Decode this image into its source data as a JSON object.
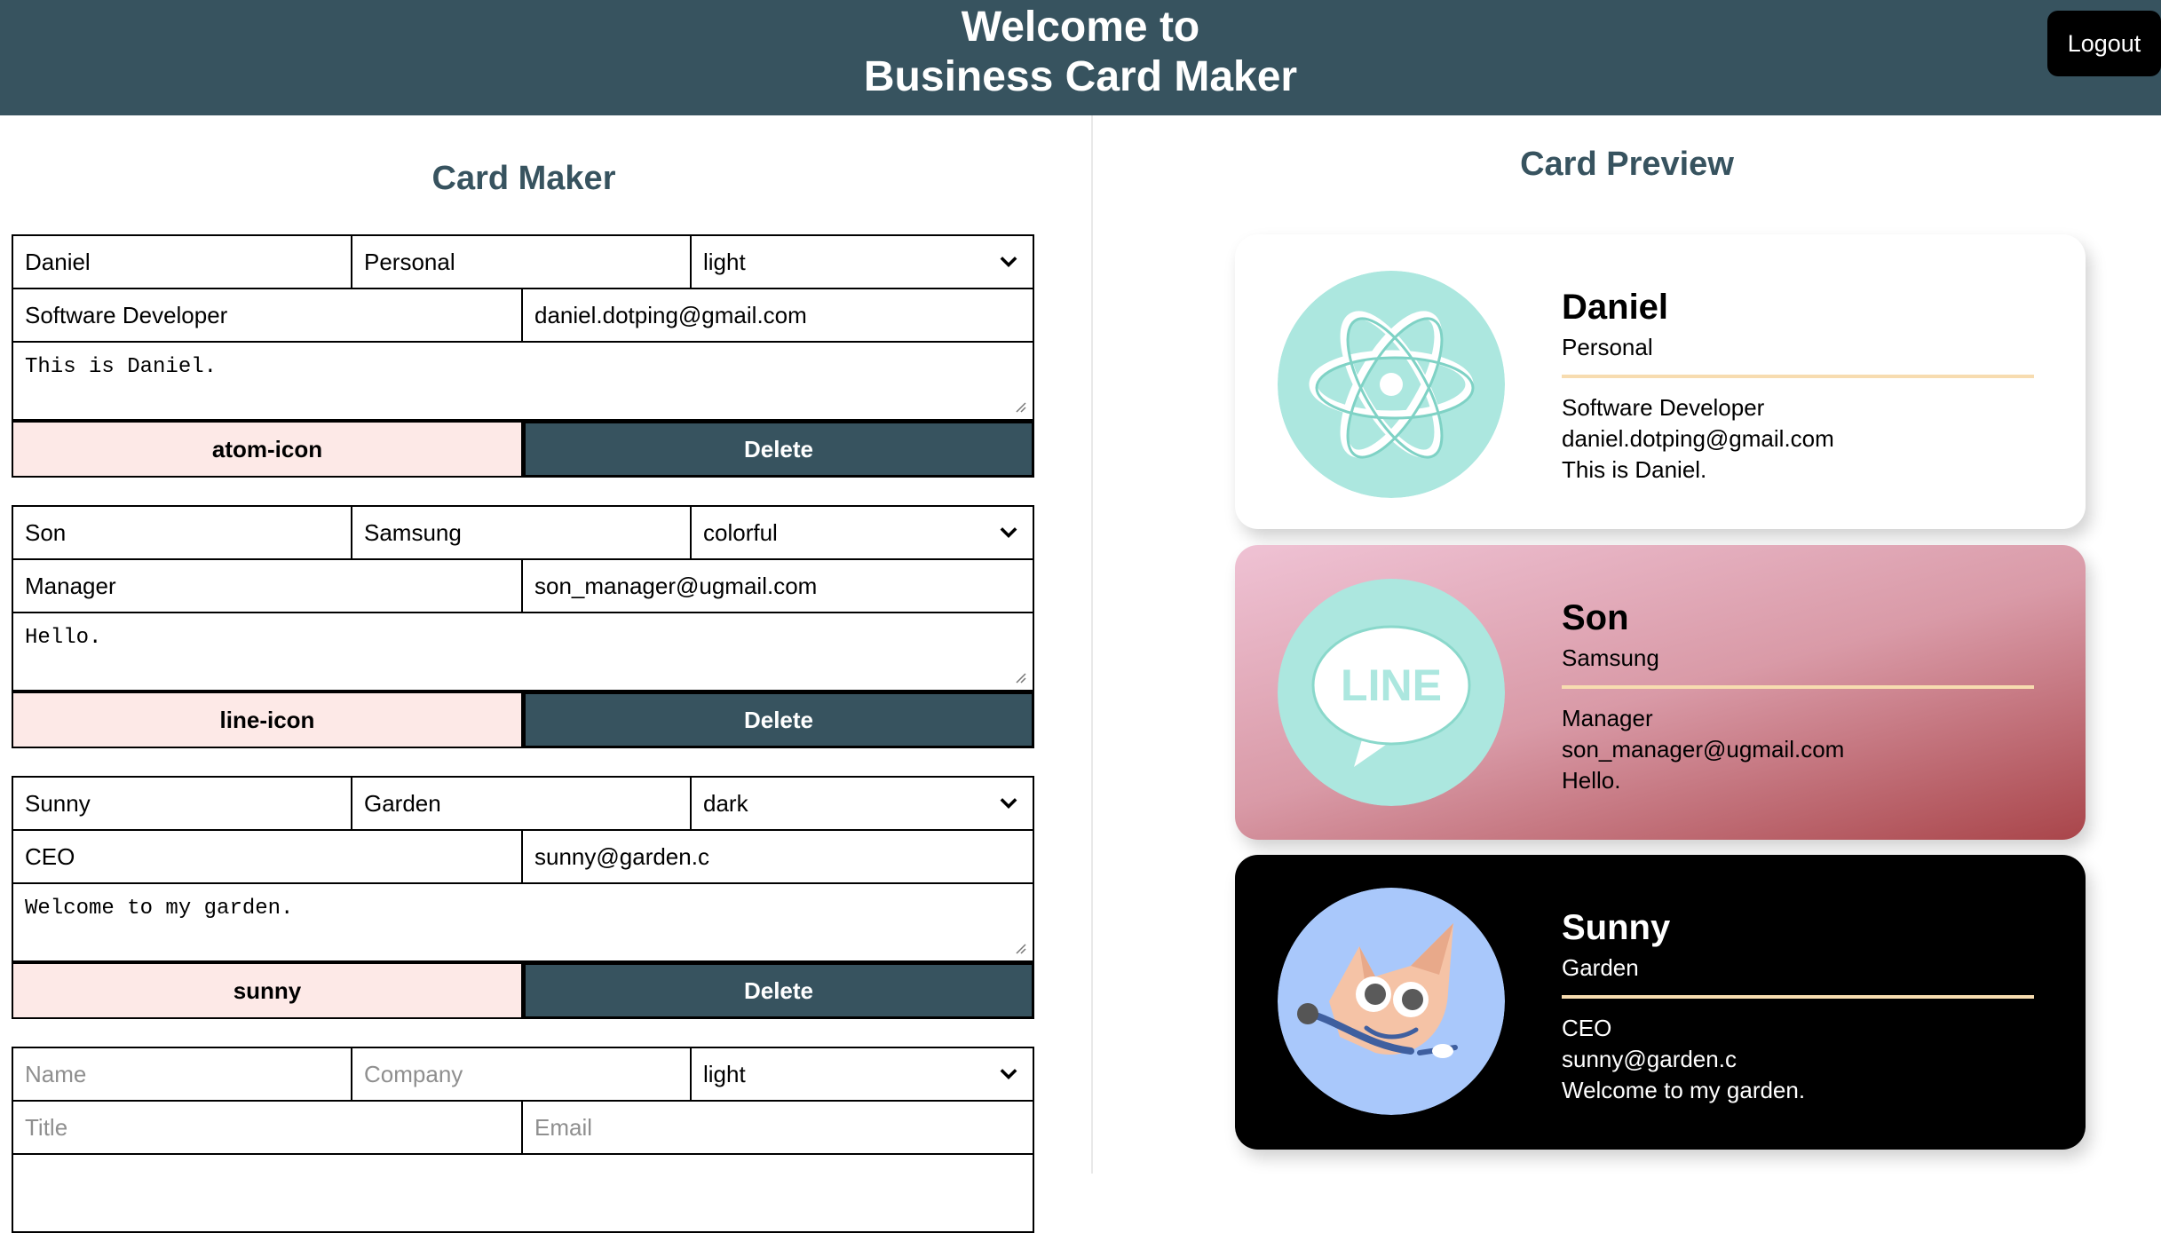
{
  "header": {
    "title_line1": "Welcome to",
    "title_line2": "Business Card Maker",
    "logout_label": "Logout"
  },
  "maker": {
    "title": "Card Maker",
    "delete_label": "Delete",
    "cards": [
      {
        "name": "Daniel",
        "company": "Personal",
        "theme": "light",
        "title": "Software Developer",
        "email": "daniel.dotping@gmail.com",
        "message": "This is Daniel.",
        "file": "atom-icon"
      },
      {
        "name": "Son",
        "company": "Samsung",
        "theme": "colorful",
        "title": "Manager",
        "email": "son_manager@ugmail.com",
        "message": "Hello.",
        "file": "line-icon"
      },
      {
        "name": "Sunny",
        "company": "Garden",
        "theme": "dark",
        "title": "CEO",
        "email": "sunny@garden.c",
        "message": "Welcome to my garden.",
        "file": "sunny"
      }
    ],
    "new_card": {
      "name_placeholder": "Name",
      "company_placeholder": "Company",
      "theme": "light",
      "title_placeholder": "Title",
      "email_placeholder": "Email"
    }
  },
  "preview": {
    "title": "Card Preview",
    "colors": {
      "header": "#37535f",
      "file_button": "#fde9e7",
      "avatar_bg": "#ace7df",
      "rule": "#f7dcb0"
    },
    "cards": [
      {
        "name": "Daniel",
        "company": "Personal",
        "title": "Software Developer",
        "email": "daniel.dotping@gmail.com",
        "message": "This is Daniel.",
        "icon": "atom-icon",
        "theme": "light"
      },
      {
        "name": "Son",
        "company": "Samsung",
        "title": "Manager",
        "email": "son_manager@ugmail.com",
        "message": "Hello.",
        "icon": "line-icon",
        "theme": "colorful",
        "icon_text": "LINE"
      },
      {
        "name": "Sunny",
        "company": "Garden",
        "title": "CEO",
        "email": "sunny@garden.c",
        "message": "Welcome to my garden.",
        "icon": "fox-mascot-icon",
        "theme": "dark"
      }
    ]
  }
}
